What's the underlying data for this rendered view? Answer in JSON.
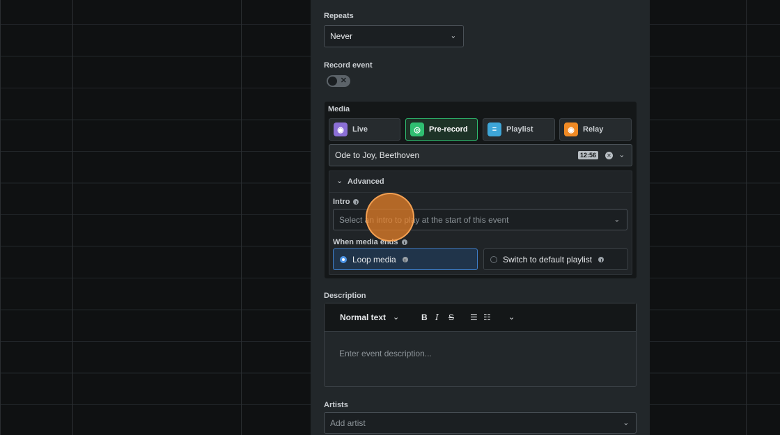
{
  "repeats": {
    "label": "Repeats",
    "value": "Never"
  },
  "record": {
    "label": "Record event",
    "enabled": false
  },
  "media": {
    "label": "Media",
    "tabs": [
      {
        "label": "Live",
        "icon": "broadcast-icon",
        "color": "#8b6fd6"
      },
      {
        "label": "Pre-record",
        "icon": "record-icon",
        "color": "#2fbf71"
      },
      {
        "label": "Playlist",
        "icon": "playlist-icon",
        "color": "#3ea6d8"
      },
      {
        "label": "Relay",
        "icon": "relay-icon",
        "color": "#f08a24"
      }
    ],
    "selected_tab": "Pre-record",
    "track": {
      "title": "Ode to Joy, Beethoven",
      "duration": "12:56"
    }
  },
  "advanced": {
    "label": "Advanced",
    "intro": {
      "label": "Intro",
      "placeholder": "Select an intro to play at the start of this event"
    },
    "media_ends": {
      "label": "When media ends",
      "options": [
        "Loop media",
        "Switch to default playlist"
      ],
      "selected": "Loop media"
    }
  },
  "description": {
    "label": "Description",
    "format": "Normal text",
    "placeholder": "Enter event description..."
  },
  "artists": {
    "label": "Artists",
    "placeholder": "Add artist"
  },
  "colors": {
    "accent_green": "#2fbf71",
    "accent_blue": "#4e96e8",
    "cursor": "#eb8228"
  }
}
